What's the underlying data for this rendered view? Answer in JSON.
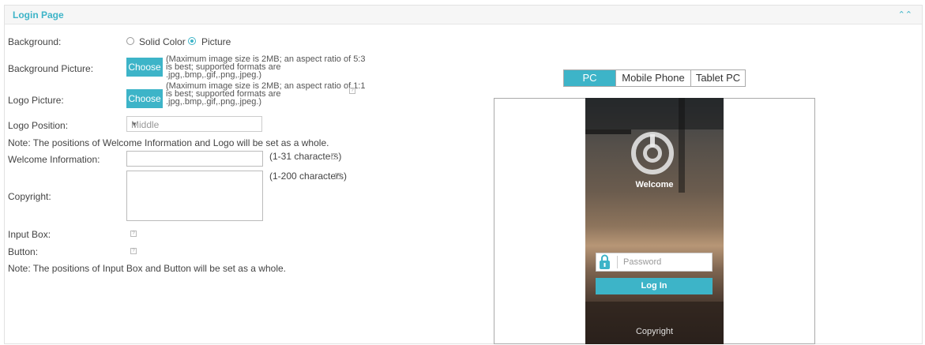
{
  "panel": {
    "title": "Login Page",
    "collapse_icon": "chevrons-up-icon"
  },
  "form": {
    "background": {
      "label": "Background:",
      "options": [
        "Solid Color",
        "Picture"
      ],
      "selected": "Picture"
    },
    "background_picture": {
      "label": "Background Picture:",
      "button": "Choose",
      "hint": [
        "(Maximum image size is 2MB; an aspect ratio of 5:3",
        "is best; supported formats are",
        ".jpg,.bmp,.gif,.png,.jpeg.)"
      ]
    },
    "logo_picture": {
      "label": "Logo Picture:",
      "button": "Choose",
      "hint": [
        "(Maximum image size is 2MB; an aspect ratio of 1:1",
        "is best; supported formats are",
        ".jpg,.bmp,.gif,.png,.jpeg.)"
      ]
    },
    "logo_position": {
      "label": "Logo Position:",
      "value": "Middle"
    },
    "note1": "Note: The positions of Welcome Information and Logo will be set as a whole.",
    "welcome_information": {
      "label": "Welcome Information:",
      "value": "",
      "hint": "(1-31 characters)"
    },
    "copyright": {
      "label": "Copyright:",
      "value": "",
      "hint": "(1-200 characters)"
    },
    "input_box": {
      "label": "Input Box:"
    },
    "button": {
      "label": "Button:"
    },
    "note2": "Note: The positions of Input Box and Button will be set as a whole."
  },
  "preview": {
    "tabs": [
      "PC",
      "Mobile Phone",
      "Tablet PC"
    ],
    "active_tab": "PC",
    "welcome": "Welcome",
    "password_placeholder": "Password",
    "login_button": "Log In",
    "copyright": "Copyright"
  },
  "colors": {
    "accent": "#3db4c8"
  }
}
